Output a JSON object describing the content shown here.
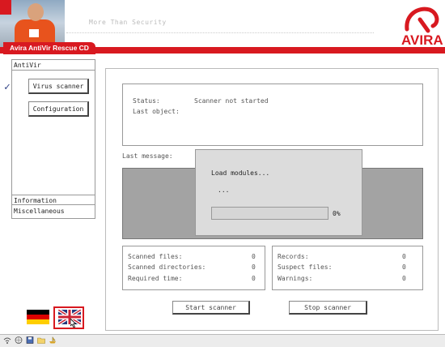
{
  "header": {
    "tagline": "More Than Security",
    "product_title": "Avira AntiVir Rescue CD",
    "logo_text": "AVIRA"
  },
  "sidebar": {
    "section_antivir": "AntiVir",
    "virus_scanner": "Virus scanner",
    "configuration": "Configuration",
    "section_information": "Information",
    "section_misc": "Miscellaneous",
    "checkmark": "✓"
  },
  "status": {
    "status_label": "Status:",
    "status_value": "Scanner not started",
    "last_object_label": "Last object:",
    "last_message_label": "Last message:"
  },
  "dialog": {
    "title": "Load modules...",
    "dots": "...",
    "progress_percent": "0%",
    "progress_value": 0
  },
  "stats_left": [
    {
      "label": "Scanned files:",
      "value": "0"
    },
    {
      "label": "Scanned directories:",
      "value": "0"
    },
    {
      "label": "Required time:",
      "value": "0"
    }
  ],
  "stats_right": [
    {
      "label": "Records:",
      "value": "0"
    },
    {
      "label": "Suspect files:",
      "value": "0"
    },
    {
      "label": "Warnings:",
      "value": "0"
    }
  ],
  "buttons": {
    "start": "Start scanner",
    "stop": "Stop scanner"
  },
  "colors": {
    "brand_red": "#d81920"
  },
  "taskbar_icons": [
    "wifi-icon",
    "globe-icon",
    "floppy-icon",
    "folder-icon",
    "boat-icon"
  ]
}
